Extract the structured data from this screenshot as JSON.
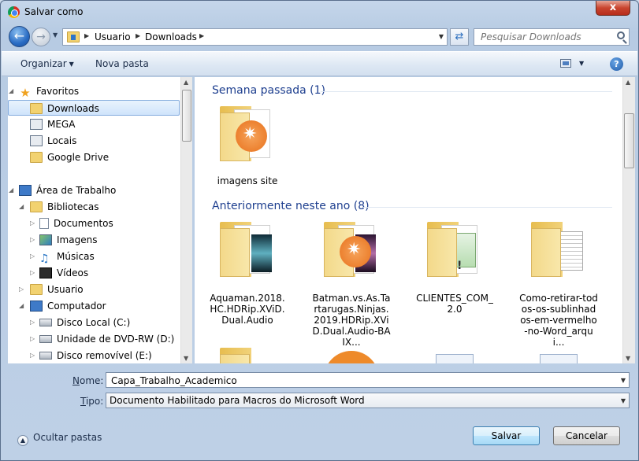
{
  "window": {
    "title": "Salvar como",
    "close_label": "x"
  },
  "nav": {
    "back_icon": "back-arrow-icon",
    "forward_icon": "forward-arrow-icon"
  },
  "address": {
    "crumbs": [
      "Usuario",
      "Downloads"
    ]
  },
  "search": {
    "placeholder": "Pesquisar Downloads"
  },
  "toolbar": {
    "organize_label": "Organizar",
    "new_folder_label": "Nova pasta",
    "help_label": "?"
  },
  "sidebar": {
    "items": [
      {
        "label": "Favoritos"
      },
      {
        "label": "Downloads"
      },
      {
        "label": "MEGA"
      },
      {
        "label": "Locais"
      },
      {
        "label": "Google Drive"
      },
      {
        "label": "Área de Trabalho"
      },
      {
        "label": "Bibliotecas"
      },
      {
        "label": "Documentos"
      },
      {
        "label": "Imagens"
      },
      {
        "label": "Músicas"
      },
      {
        "label": "Vídeos"
      },
      {
        "label": "Usuario"
      },
      {
        "label": "Computador"
      },
      {
        "label": "Disco Local (C:)"
      },
      {
        "label": "Unidade de DVD-RW (D:)"
      },
      {
        "label": "Disco removível (E:)"
      }
    ]
  },
  "content": {
    "groups": [
      {
        "title": "Semana passada (1)"
      },
      {
        "title": "Anteriormente neste ano (8)"
      }
    ],
    "files": [
      {
        "name": "imagens site"
      },
      {
        "name": "Aquaman.2018.HC.HDRip.XViD.Dual.Audio"
      },
      {
        "name": "Batman.vs.As.Tartarugas.Ninjas.2019.HDRip.XViD.Dual.Audio-BAIX..."
      },
      {
        "name": "CLIENTES_COM_2.0"
      },
      {
        "name": "Como-retirar-todos-os-sublinhados-em-vermelho-no-Word_arqui..."
      }
    ]
  },
  "form": {
    "name_label_u": "N",
    "name_label_rest": "ome:",
    "name_value": "Capa_Trabalho_Academico",
    "type_label_u": "T",
    "type_label_rest": "ipo:",
    "type_value": "Documento Habilitado para Macros do Microsoft Word"
  },
  "footer": {
    "hide_folders_label": "Ocultar pastas",
    "save_label": "Salvar",
    "cancel_label": "Cancelar"
  }
}
